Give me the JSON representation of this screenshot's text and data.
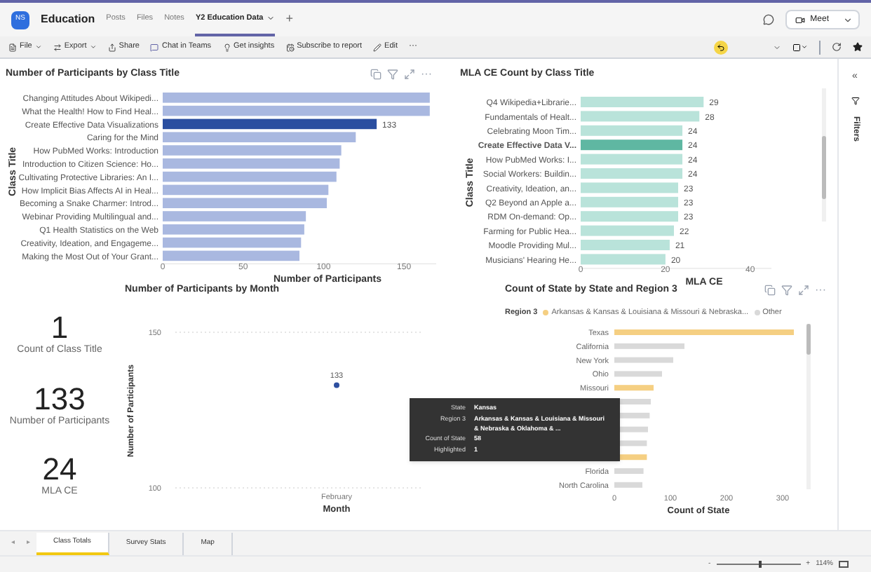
{
  "app_bar": {
    "team_avatar": "NS",
    "team_name": "Education",
    "tabs": [
      {
        "label": "Posts",
        "selected": false
      },
      {
        "label": "Files",
        "selected": false
      },
      {
        "label": "Notes",
        "selected": false
      },
      {
        "label": "Y2 Education Data",
        "selected": true
      }
    ],
    "add_tab": "+",
    "meet_button": "Meet"
  },
  "toolbar": {
    "items": [
      {
        "label": "File",
        "dropdown": true
      },
      {
        "label": "Export",
        "dropdown": true
      },
      {
        "label": "Share",
        "dropdown": false
      },
      {
        "label": "Chat in Teams",
        "dropdown": false
      },
      {
        "label": "Get insights",
        "dropdown": false
      },
      {
        "label": "Subscribe to report",
        "dropdown": false
      },
      {
        "label": "Edit",
        "dropdown": false
      }
    ],
    "more": "···"
  },
  "participants_chart": {
    "title": "Number of Participants by Class Title",
    "more": "···",
    "chart_data": {
      "type": "bar",
      "orientation": "horizontal",
      "xlabel": "Number of Participants",
      "ylabel": "Class Title",
      "categories": [
        "Changing Attitudes About Wikipedi...",
        "What the Health! How to Find Heal...",
        "Create Effective Data Visualizations",
        "Caring for the Mind",
        "How PubMed Works: Introduction",
        "Introduction to Citizen Science: Ho...",
        "Cultivating Protective Libraries: An I...",
        "How Implicit Bias Affects AI in Heal...",
        "Becoming a Snake Charmer: Introd...",
        "Webinar Providing Multilingual and...",
        "Q1 Health Statistics on the Web",
        "Creativity, Ideation, and Engageme...",
        "Making the Most Out of Your Grant..."
      ],
      "series": [
        {
          "color": "#a9b8e0",
          "values": [
            166,
            166,
            null,
            120,
            111,
            110,
            108,
            103,
            102,
            89,
            88,
            86,
            85
          ]
        },
        {
          "color": "#2a4ea0",
          "values": [
            null,
            null,
            133,
            null,
            null,
            null,
            null,
            null,
            null,
            null,
            null,
            null,
            null
          ]
        }
      ],
      "stacked": true,
      "xlim": [
        0,
        170
      ],
      "xticks": [
        0,
        50,
        100,
        150
      ],
      "value_labels": [
        null,
        null,
        "133",
        null,
        null,
        null,
        null,
        null,
        null,
        null,
        null,
        null,
        null
      ]
    }
  },
  "mla_chart": {
    "title": "MLA CE Count by Class Title",
    "chart_data": {
      "type": "bar",
      "orientation": "horizontal",
      "xlabel": "MLA CE",
      "ylabel": "Class Title",
      "categories": [
        "Q4 Wikipedia+Librarie...",
        "Fundamentals of Healt...",
        "Celebrating Moon Tim...",
        "Create Effective Data V...",
        "How PubMed Works: I...",
        "Social Workers: Buildin...",
        "Creativity, Ideation, an...",
        "Q2 Beyond an Apple a...",
        "RDM On-demand: Op...",
        "Farming for Public Hea...",
        "Moodle Providing Mul...",
        "Musicians' Hearing He..."
      ],
      "series": [
        {
          "color": "#b9e3da",
          "values": [
            29,
            28,
            24,
            null,
            24,
            24,
            23,
            23,
            23,
            22,
            21,
            20
          ]
        },
        {
          "color": "#5fb7a2",
          "values": [
            null,
            null,
            null,
            24,
            null,
            null,
            null,
            null,
            null,
            null,
            null,
            null
          ]
        }
      ],
      "stacked": true,
      "xlim": [
        0,
        45
      ],
      "xticks": [
        0,
        20,
        40
      ],
      "data_labels": true
    }
  },
  "cards": [
    {
      "value": "1",
      "label": "Count of Class Title"
    },
    {
      "value": "133",
      "label": "Number of Participants"
    },
    {
      "value": "24",
      "label": "MLA CE"
    }
  ],
  "month_chart": {
    "title": "Number of Participants by Month",
    "chart_data": {
      "type": "scatter",
      "xlabel": "Month",
      "ylabel": "Number of Participants",
      "categories": [
        "February"
      ],
      "series": [
        {
          "color": "#2d4fa0",
          "values": [
            133
          ]
        }
      ],
      "ylim": [
        100,
        150
      ],
      "yticks": [
        100,
        150
      ],
      "data_labels": true
    }
  },
  "state_chart": {
    "title": "Count of State by State and Region 3",
    "more": "···",
    "legend_title": "Region 3",
    "chart_data": {
      "type": "bar",
      "orientation": "horizontal",
      "stacked": true,
      "xlabel": "Count of State",
      "categories": [
        "Texas",
        "California",
        "New York",
        "Ohio",
        "Missouri",
        null,
        null,
        null,
        null,
        null,
        "Florida",
        "North Carolina"
      ],
      "series": [
        {
          "name": "Arkansas & Kansas & Louisiana & Missouri & Nebraska...",
          "color": "#f5cf82",
          "values": [
            320,
            0,
            0,
            0,
            70,
            0,
            0,
            0,
            0,
            58,
            0,
            0
          ]
        },
        {
          "name": "Other",
          "color": "#d9d9d9",
          "values": [
            0,
            125,
            105,
            85,
            0,
            65,
            63,
            60,
            58,
            0,
            52,
            50
          ]
        }
      ],
      "xlim": [
        0,
        330
      ],
      "xticks": [
        0,
        100,
        200,
        300
      ]
    }
  },
  "tooltip": [
    {
      "label": "State",
      "value": "Kansas"
    },
    {
      "label": "Region 3",
      "value": "Arkansas & Kansas & Louisiana & Missouri & Nebraska & Oklahoma & ..."
    },
    {
      "label": "Count of State",
      "value": "58"
    },
    {
      "label": "Highlighted",
      "value": "1"
    }
  ],
  "filters_pane": {
    "collapse": "«",
    "label": "Filters"
  },
  "page_tab_bar": {
    "scroll_left": "◂",
    "scroll_right": "▸",
    "tabs": [
      {
        "label": "Class Totals",
        "selected": true
      },
      {
        "label": "Survey Stats",
        "selected": false
      },
      {
        "label": "Map",
        "selected": false
      }
    ]
  },
  "status_bar": {
    "zoom_out": "-",
    "zoom_in": "+",
    "zoom": "114%",
    "zoom_level": {
      "level": 0.5
    }
  }
}
